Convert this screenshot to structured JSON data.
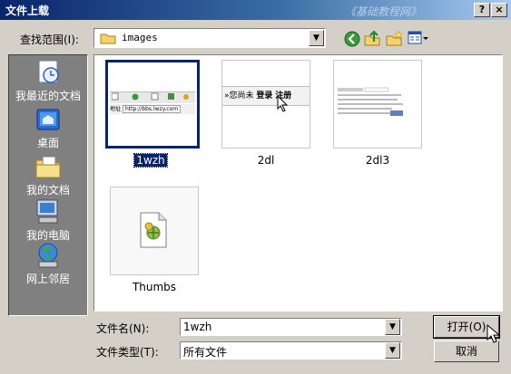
{
  "window": {
    "title": "文件上载",
    "watermark": "《基础教程网》",
    "help_glyph": "?",
    "close_glyph": "×"
  },
  "look_in": {
    "label": "查找范围(I):",
    "value": "images"
  },
  "places": [
    {
      "label": "我最近的文档",
      "icon": "recent-documents-icon"
    },
    {
      "label": "桌面",
      "icon": "desktop-icon"
    },
    {
      "label": "我的文档",
      "icon": "my-documents-icon"
    },
    {
      "label": "我的电脑",
      "icon": "my-computer-icon"
    },
    {
      "label": "网上邻居",
      "icon": "network-places-icon"
    }
  ],
  "files": [
    {
      "name": "1wzh",
      "selected": true
    },
    {
      "name": "2dl",
      "selected": false
    },
    {
      "name": "2dl3",
      "selected": false
    },
    {
      "name": "Thumbs",
      "selected": false
    }
  ],
  "thumb_2dl": {
    "text_prefix": "»您尚未",
    "text_login": "登录",
    "text_register": "注册"
  },
  "thumb_1wzh": {
    "addr_label": "地址",
    "url": "http://bbs.lwzy.com"
  },
  "filename": {
    "label": "文件名(N):",
    "value": "1wzh"
  },
  "filetype": {
    "label": "文件类型(T):",
    "value": "所有文件"
  },
  "buttons": {
    "open": "打开(O)",
    "cancel": "取消"
  },
  "colors": {
    "title_bar": "#0a246a",
    "selection": "#0a246a",
    "dialog_bg": "#d4d0c8",
    "places_bg": "#808080"
  }
}
